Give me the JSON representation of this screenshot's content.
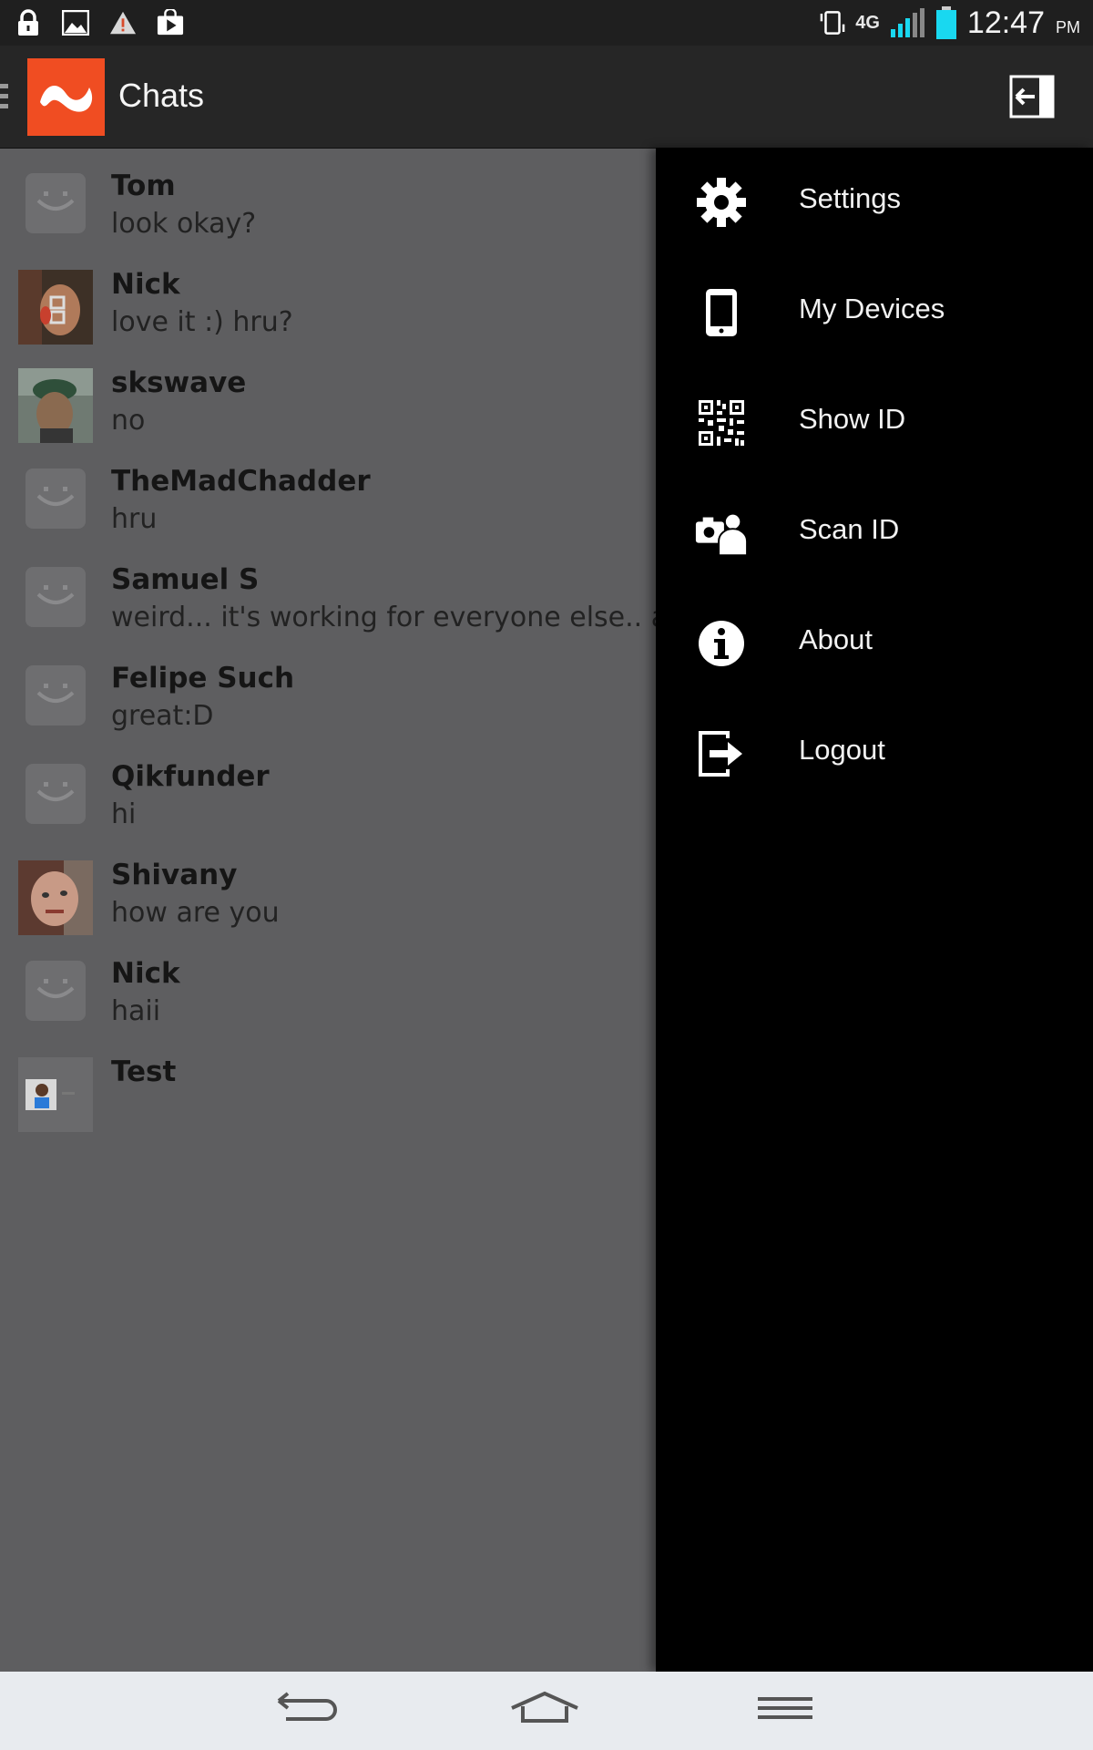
{
  "status_bar": {
    "time": "12:47",
    "ampm": "PM",
    "network": "4G",
    "icons": [
      "lock-icon",
      "image-icon",
      "warning-icon",
      "play-store-icon",
      "vibrate-icon",
      "signal-icon",
      "battery-icon"
    ],
    "battery_color": "#19d8f0"
  },
  "app_bar": {
    "title": "Chats",
    "logo_color": "#f04d22"
  },
  "chats": [
    {
      "name": "Tom",
      "message": "look okay?",
      "avatar": "default"
    },
    {
      "name": "Nick",
      "message": "love it :) hru?",
      "avatar": "photo"
    },
    {
      "name": "skswave",
      "message": "no",
      "avatar": "photo"
    },
    {
      "name": "TheMadChadder",
      "message": "hru",
      "avatar": "default"
    },
    {
      "name": "Samuel S",
      "message": "weird... it's working for everyone else.. as",
      "avatar": "default"
    },
    {
      "name": "Felipe Such",
      "message": "great:D",
      "avatar": "default"
    },
    {
      "name": "Qikfunder",
      "message": "hi",
      "avatar": "default"
    },
    {
      "name": "Shivany",
      "message": "how are you",
      "avatar": "photo"
    },
    {
      "name": "Nick",
      "message": "haii",
      "avatar": "default"
    },
    {
      "name": "Test",
      "message": "",
      "avatar": "photo"
    }
  ],
  "drawer": {
    "items": [
      {
        "label": "Settings",
        "icon": "gear-icon"
      },
      {
        "label": "My Devices",
        "icon": "phone-icon"
      },
      {
        "label": "Show ID",
        "icon": "qr-code-icon"
      },
      {
        "label": "Scan ID",
        "icon": "camera-person-icon"
      },
      {
        "label": "About",
        "icon": "info-icon"
      },
      {
        "label": "Logout",
        "icon": "logout-icon"
      }
    ]
  },
  "nav_bar": {
    "buttons": [
      "back-icon",
      "home-icon",
      "menu-icon"
    ]
  }
}
